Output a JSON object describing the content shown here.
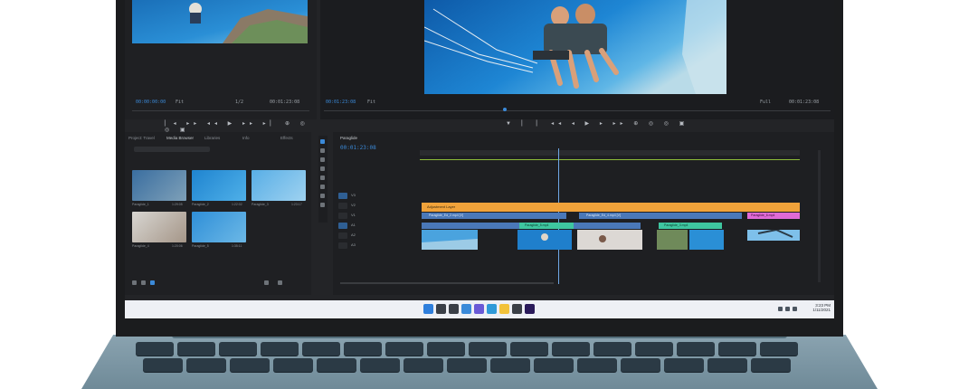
{
  "source_monitor": {
    "timecode_in": "00:00:00:00",
    "zoom": "Fit",
    "timecode_out": "00:01:23:08",
    "fraction": "1/2"
  },
  "program_monitor": {
    "timecode_in": "00:01:23:08",
    "zoom": "Fit",
    "fraction": "Full",
    "timecode_out": "00:01:23:08"
  },
  "project_panel": {
    "tabs": [
      "Project: Travel",
      "Media Browser",
      "Libraries",
      "Info",
      "Effects"
    ],
    "search_placeholder": "",
    "clips": [
      {
        "name": "Paraglide_1",
        "dur": "1:29:05"
      },
      {
        "name": "Paraglide_2",
        "dur": "1:22:02"
      },
      {
        "name": "Paraglide_3",
        "dur": "1:23:17"
      },
      {
        "name": "Paraglide_4",
        "dur": "1:20:06"
      },
      {
        "name": "Paraglide_5",
        "dur": "1:35:11"
      }
    ]
  },
  "timeline": {
    "sequence_tab": "Paraglide",
    "timecode": "00:01:23:08",
    "track_labels": [
      "V3",
      "V2",
      "V1",
      "A1",
      "A2",
      "A3"
    ],
    "clips": [
      {
        "label": "Adjustment Layer",
        "color": "#f0a23a"
      },
      {
        "label": "Paraglide_Ed_2.mp4 [V]",
        "color": "#5aa6e8"
      },
      {
        "label": "Paraglide_5.mp4",
        "color": "#3ec6a0"
      },
      {
        "label": "Paraglide_Ed_4.mp4 [V]",
        "color": "#5aa6e8"
      },
      {
        "label": "Paraglide_3.mp4",
        "color": "#3ec6a0"
      },
      {
        "label": "Paraglide_6.mp4",
        "color": "#e06ad6"
      }
    ]
  },
  "taskbar": {
    "time": "3:23 PM",
    "date": "1/11/2021",
    "icons": [
      "windows-icon",
      "search-icon",
      "task-view-icon",
      "widgets-icon",
      "chat-icon",
      "edge-icon",
      "file-explorer-icon",
      "store-icon",
      "premiere-icon"
    ]
  },
  "colors": {
    "accent_timecode": "#3b8ad9",
    "adjustment_clip": "#f0a23a",
    "video_clip": "#5aa6e8",
    "green_clip": "#3ec6a0",
    "pink_clip": "#e06ad6"
  }
}
